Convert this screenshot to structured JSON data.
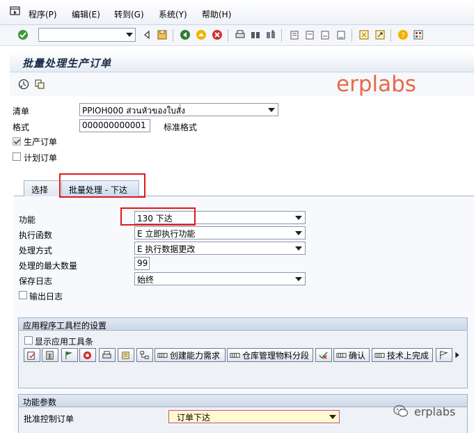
{
  "menu": {
    "items": [
      "程序(P)",
      "编辑(E)",
      "转到(G)",
      "系统(Y)",
      "帮助(H)"
    ]
  },
  "toolbar": {
    "command_value": ""
  },
  "title": "批量处理生产订单",
  "watermark": "erplabs",
  "form": {
    "list_label": "清单",
    "list_value": "PPIOH000 ส่วนหัวของใบสั่ง",
    "layout_label": "格式",
    "layout_value": "000000000001",
    "layout_desc": "标准格式",
    "prod_order_label": "生产订单",
    "planned_order_label": "计划订单"
  },
  "tabs": [
    "选择",
    "批量处理 - 下达"
  ],
  "mass": {
    "function_label": "功能",
    "function_value": "130 下达",
    "exec_label": "执行函数",
    "exec_value": "E 立即执行功能",
    "proc_label": "处理方式",
    "proc_value": "E 执行数据更改",
    "max_label": "处理的最大数量",
    "max_value": "99",
    "savelog_label": "保存日志",
    "savelog_value": "始终",
    "outlog_label": "输出日志"
  },
  "appbar_group": {
    "title": "应用程序工具栏的设置",
    "show_label": "显示应用工具条",
    "buttons": [
      "创建能力需求",
      "仓库管理物料分段",
      "确认",
      "技术上完成"
    ]
  },
  "params_group": {
    "title": "功能参数",
    "release_label": "批准控制订单",
    "release_value": "订单下达"
  },
  "footer_brand": "erplabs"
}
